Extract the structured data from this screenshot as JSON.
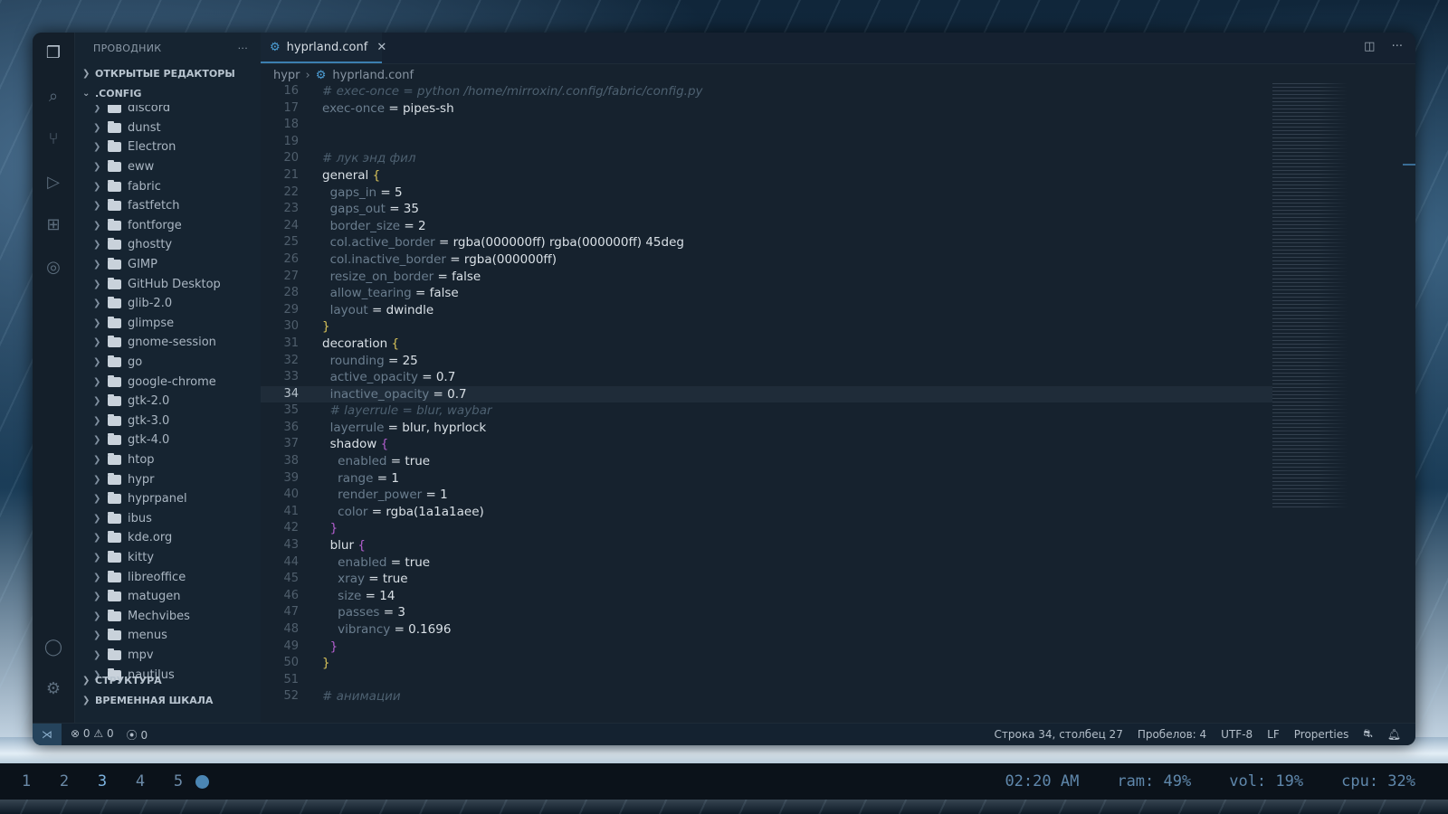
{
  "explorer": {
    "title": "ПРОВОДНИК",
    "more": "···",
    "open_editors": "ОТКРЫТЫЕ РЕДАКТОРЫ",
    "root": ".CONFIG",
    "folders": [
      "discord",
      "dunst",
      "Electron",
      "eww",
      "fabric",
      "fastfetch",
      "fontforge",
      "ghostty",
      "GIMP",
      "GitHub Desktop",
      "glib-2.0",
      "glimpse",
      "gnome-session",
      "go",
      "google-chrome",
      "gtk-2.0",
      "gtk-3.0",
      "gtk-4.0",
      "htop",
      "hypr",
      "hyprpanel",
      "ibus",
      "kde.org",
      "kitty",
      "libreoffice",
      "matugen",
      "Mechvibes",
      "menus",
      "mpv",
      "nautilus"
    ],
    "outline": "СТРУКТУРА",
    "timeline": "ВРЕМЕННАЯ ШКАЛА"
  },
  "tab": {
    "label": "hyprland.conf",
    "close": "✕"
  },
  "breadcrumb": {
    "folder": "hypr",
    "file": "hyprland.conf"
  },
  "code_lines": [
    {
      "n": "16",
      "t": "# exec-once = python /home/mirroxin/.config/fabric/config.py"
    },
    {
      "n": "17",
      "t": "exec-once = pipes-sh"
    },
    {
      "n": "18",
      "t": ""
    },
    {
      "n": "19",
      "t": ""
    },
    {
      "n": "20",
      "t": "# лук энд фил"
    },
    {
      "n": "21",
      "t": "general {"
    },
    {
      "n": "22",
      "t": "  gaps_in = 5"
    },
    {
      "n": "23",
      "t": "  gaps_out = 35"
    },
    {
      "n": "24",
      "t": "  border_size = 2"
    },
    {
      "n": "25",
      "t": "  col.active_border = rgba(000000ff) rgba(000000ff) 45deg"
    },
    {
      "n": "26",
      "t": "  col.inactive_border = rgba(000000ff)"
    },
    {
      "n": "27",
      "t": "  resize_on_border = false"
    },
    {
      "n": "28",
      "t": "  allow_tearing = false"
    },
    {
      "n": "29",
      "t": "  layout = dwindle"
    },
    {
      "n": "30",
      "t": "}"
    },
    {
      "n": "31",
      "t": "decoration {"
    },
    {
      "n": "32",
      "t": "  rounding = 25"
    },
    {
      "n": "33",
      "t": "  active_opacity = 0.7"
    },
    {
      "n": "34",
      "t": "  inactive_opacity = 0.7"
    },
    {
      "n": "35",
      "t": "  # layerrule = blur, waybar"
    },
    {
      "n": "36",
      "t": "  layerrule = blur, hyprlock"
    },
    {
      "n": "37",
      "t": "  shadow {"
    },
    {
      "n": "38",
      "t": "    enabled = true"
    },
    {
      "n": "39",
      "t": "    range = 1"
    },
    {
      "n": "40",
      "t": "    render_power = 1"
    },
    {
      "n": "41",
      "t": "    color = rgba(1a1a1aee)"
    },
    {
      "n": "42",
      "t": "  }"
    },
    {
      "n": "43",
      "t": "  blur {"
    },
    {
      "n": "44",
      "t": "    enabled = true"
    },
    {
      "n": "45",
      "t": "    xray = true"
    },
    {
      "n": "46",
      "t": "    size = 14"
    },
    {
      "n": "47",
      "t": "    passes = 3"
    },
    {
      "n": "48",
      "t": "    vibrancy = 0.1696"
    },
    {
      "n": "49",
      "t": "  }"
    },
    {
      "n": "50",
      "t": "}"
    },
    {
      "n": "51",
      "t": ""
    },
    {
      "n": "52",
      "t": "# анимации"
    }
  ],
  "current_line": "34",
  "status": {
    "errors": "0",
    "warnings": "0",
    "ports": "0",
    "position": "Строка 34, столбец 27",
    "spaces": "Пробелов: 4",
    "encoding": "UTF-8",
    "eol": "LF",
    "language": "Properties"
  },
  "taskbar": {
    "workspaces": [
      "1",
      "2",
      "3",
      "4",
      "5"
    ],
    "active_workspace": "3",
    "clock": "02:20 AM",
    "ram": "ram: 49%",
    "vol": "vol: 19%",
    "cpu": "cpu: 32%"
  },
  "colors": {
    "accent": "#3c7fb0",
    "editor_bg": "#16222e",
    "brace_outer": "#d8c35a",
    "brace_inner": "#b45fd0"
  }
}
